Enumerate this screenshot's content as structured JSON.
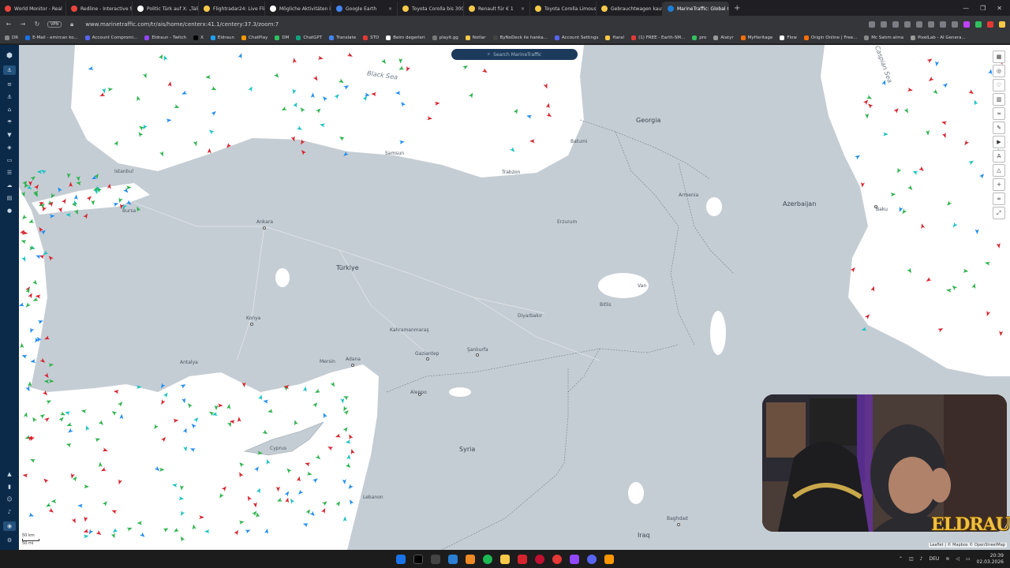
{
  "browser": {
    "tabs": [
      {
        "label": "World Monitor - Real",
        "color": "#e8453c"
      },
      {
        "label": "Redline - Interactive Strat",
        "color": "#e8453c"
      },
      {
        "label": "Politic Türk auf X: „Taliban",
        "color": "#ffffff"
      },
      {
        "label": "Flightradar24: Live Flight",
        "color": "#f7c948"
      },
      {
        "label": "Mögliche Aktivitäten in G",
        "color": "#ffffff"
      },
      {
        "label": "Google Earth",
        "color": "#4285f4"
      },
      {
        "label": "Toyota Corolla bis 3000 E",
        "color": "#f7c948"
      },
      {
        "label": "Renault für € 1",
        "color": "#f7c948"
      },
      {
        "label": "Toyota Corolla Limousine",
        "color": "#f7c948"
      },
      {
        "label": "Gebrauchtwagen kaufen",
        "color": "#f7c948"
      },
      {
        "label": "MarineTraffic: Global Gen",
        "color": "#1c7ed6",
        "active": true
      }
    ],
    "new_tab": "+",
    "window_controls": [
      "—",
      "❐",
      "✕"
    ],
    "vpn": "VPN",
    "url": "www.marinetraffic.com/tr/ais/home/centerx:41.1/centery:37.3/zoom:7"
  },
  "bookmarks": [
    {
      "label": "DR",
      "color": "#888"
    },
    {
      "label": "E-Mail - emircan ko...",
      "color": "#1a73e8"
    },
    {
      "label": "Account Compromi...",
      "color": "#5865f2"
    },
    {
      "label": "Eldraun - Twitch",
      "color": "#9146ff"
    },
    {
      "label": "X",
      "color": "#000000"
    },
    {
      "label": "Eldraun",
      "color": "#1da1f2"
    },
    {
      "label": "ChatPlay",
      "color": "#ff9900"
    },
    {
      "label": "DM",
      "color": "#30c060"
    },
    {
      "label": "ChatGPT",
      "color": "#10a37f"
    },
    {
      "label": "Translate",
      "color": "#4285f4"
    },
    {
      "label": "STD",
      "color": "#e53935"
    },
    {
      "label": "Beim degerleri",
      "color": "#ffffff"
    },
    {
      "label": "playit.gg",
      "color": "#777"
    },
    {
      "label": "Notlar",
      "color": "#f7c948"
    },
    {
      "label": "ByNoDeck ile hanka...",
      "color": "#444"
    },
    {
      "label": "Account Settings",
      "color": "#5865f2"
    },
    {
      "label": "Haral",
      "color": "#f7c948"
    },
    {
      "label": "(1) FREE - Earth-SM...",
      "color": "#e53935"
    },
    {
      "label": "pro",
      "color": "#30c060"
    },
    {
      "label": "Alatyr",
      "color": "#999"
    },
    {
      "label": "MyHeritage",
      "color": "#ff6f00"
    },
    {
      "label": "Flow",
      "color": "#ffffff"
    },
    {
      "label": "Origin Online | Free...",
      "color": "#ff6f00"
    },
    {
      "label": "Mc Satım alma",
      "color": "#888"
    },
    {
      "label": "PixelLab - AI Genera...",
      "color": "#999"
    }
  ],
  "map": {
    "search_placeholder": "Search MarineTraffic",
    "labels": {
      "black_sea": "Black Sea",
      "caspian_sea": "Caspian Sea",
      "turkiye": "Türkiye",
      "georgia": "Georgia",
      "armenia": "Armenia",
      "azerbaijan": "Azerbaijan",
      "syria": "Syria",
      "iraq": "Iraq",
      "cyprus": "Cyprus",
      "lebanon": "Lebanon",
      "istanbul": "Istanbul",
      "ankara": "Ankara",
      "konya": "Konya",
      "adana": "Adana",
      "antalya": "Antalya",
      "aleppo": "Aleppo",
      "gaziantep": "Gaziantep",
      "sanliurfa": "Şanlıurfa",
      "diyarbakir": "Diyarbakır",
      "baku": "Baku",
      "baghdad": "Baghdad",
      "bursa": "Bursa",
      "samsun": "Samsun",
      "trabzon": "Trabzon",
      "kahramanmaras": "Kahramanmaraş",
      "batumi": "Batumi",
      "bitlis": "Bitlis",
      "van": "Van",
      "erzurum": "Erzurum",
      "mersin": "Mersin"
    },
    "scale": [
      "50 km",
      "50 mi"
    ],
    "attribution": "Leaflet | © Mapbox © OpenStreetMap"
  },
  "overlay": {
    "brand": "ELDRAUN"
  },
  "taskbar": {
    "icons": [
      "windows",
      "x",
      "chatgpt",
      "vscode",
      "vlc",
      "spotify",
      "folder",
      "cam",
      "opera-gx",
      "opera",
      "twitch",
      "discord",
      "paint"
    ],
    "tray_lang": "DEU",
    "time": "20:39",
    "date": "02.03.2026"
  },
  "colors": {
    "land": "#c5cdd4",
    "water": "#ffffff",
    "ship_cargo": "#2bb24c",
    "ship_tanker": "#d6242e",
    "ship_passenger": "#1f8cf0",
    "ship_other": "#19c1c1",
    "sidebar": "#0b2a4a"
  }
}
